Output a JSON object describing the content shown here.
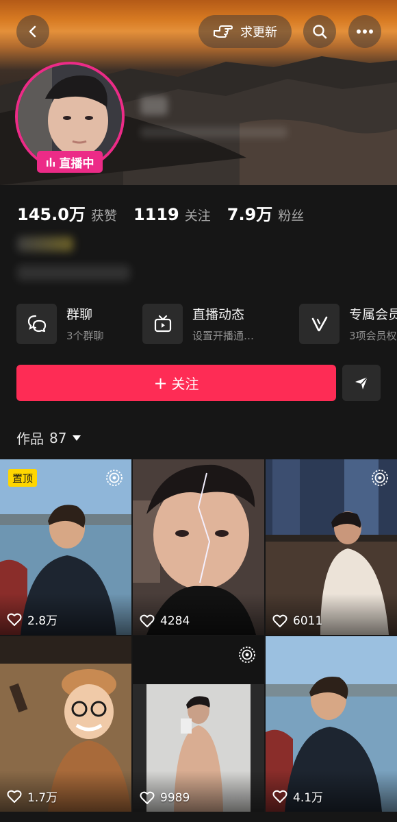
{
  "header": {
    "update_label": "求更新"
  },
  "profile": {
    "live_label": "直播中"
  },
  "stats": [
    {
      "value": "145.0万",
      "label": "获赞"
    },
    {
      "value": "1119",
      "label": "关注"
    },
    {
      "value": "7.9万",
      "label": "粉丝"
    }
  ],
  "features": [
    {
      "title": "群聊",
      "subtitle": "3个群聊",
      "icon": "group-chat-icon"
    },
    {
      "title": "直播动态",
      "subtitle": "设置开播通…",
      "icon": "tv-icon"
    },
    {
      "title": "专属会员",
      "subtitle": "3项会员权",
      "icon": "vip-check-icon"
    }
  ],
  "actions": {
    "follow_label": "关注"
  },
  "works": {
    "label": "作品",
    "count": "87"
  },
  "videos": [
    {
      "likes": "2.8万",
      "pinned": "置顶"
    },
    {
      "likes": "4284"
    },
    {
      "likes": "6011"
    },
    {
      "likes": "1.7万"
    },
    {
      "likes": "9989"
    },
    {
      "likes": "4.1万"
    }
  ],
  "colors": {
    "accent_follow": "#fe2c55",
    "live_pink": "#ec2b87",
    "pin_yellow": "#ffd600",
    "background": "#161616"
  }
}
